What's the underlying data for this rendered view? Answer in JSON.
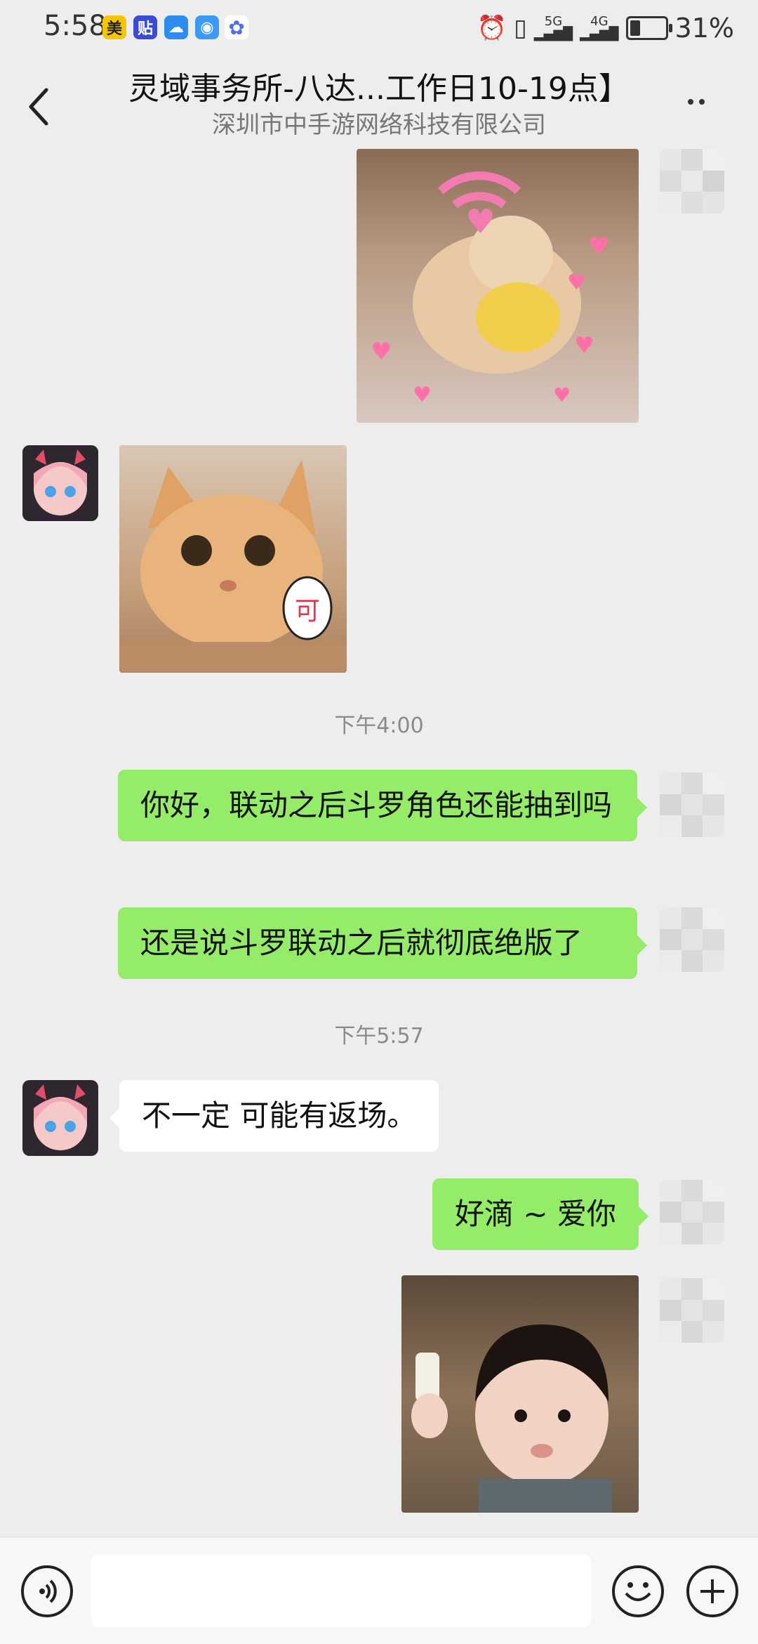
{
  "status_bar": {
    "time": "5:58",
    "apps": [
      {
        "icon": "meituan-icon",
        "glyph": "美",
        "color": "#f7c500"
      },
      {
        "icon": "tieba-icon",
        "glyph": "贴",
        "color": "#3a4bd8"
      },
      {
        "icon": "weather-icon",
        "glyph": "☁",
        "color": "#2d8cf0"
      },
      {
        "icon": "browser-icon",
        "glyph": "◉",
        "color": "#3b9af5"
      },
      {
        "icon": "baidu-icon",
        "glyph": "✿",
        "color": "#4e6ef2"
      }
    ],
    "network_top": "5G",
    "network_bottom": "4G",
    "battery": "31%",
    "battery_level": 0.31
  },
  "header": {
    "title": "灵域事务所-八达...工作日10-19点】",
    "subtitle": "深圳市中手游网络科技有限公司"
  },
  "messages": {
    "ts1": "下午4:00",
    "msg1": "你好，联动之后斗罗角色还能抽到吗",
    "msg2": "还是说斗罗联动之后就彻底绝版了",
    "ts2": "下午5:57",
    "msg3": "不一定 可能有返场。",
    "msg4": "好滴 ~ 爱你",
    "sticker_text": "可"
  },
  "colors": {
    "bubble_green": "#95ec69",
    "background": "#ededed"
  }
}
